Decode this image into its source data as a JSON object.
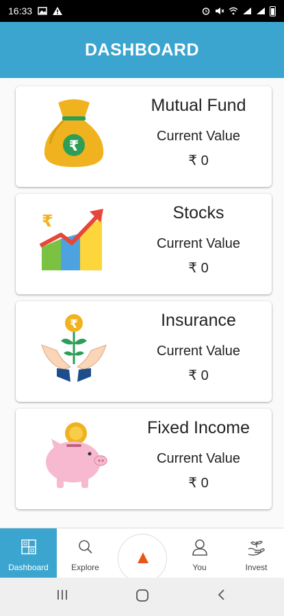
{
  "status_bar": {
    "time": "16:33",
    "right_icons": [
      "alarm-icon",
      "mute-icon",
      "wifi-icon",
      "signal-icon",
      "signal-icon",
      "battery-icon"
    ]
  },
  "header": {
    "title": "DASHBOARD",
    "color": "#3ba5cf"
  },
  "cards": [
    {
      "title": "Mutual Fund",
      "subtitle": "Current Value",
      "value": "₹ 0",
      "icon": "money-bag-icon"
    },
    {
      "title": "Stocks",
      "subtitle": "Current Value",
      "value": "₹ 0",
      "icon": "growth-chart-icon"
    },
    {
      "title": "Insurance",
      "subtitle": "Current Value",
      "value": "₹ 0",
      "icon": "hands-plant-icon"
    },
    {
      "title": "Fixed Income",
      "subtitle": "Current Value",
      "value": "₹ 0",
      "icon": "piggy-bank-icon"
    }
  ],
  "bottom_nav": {
    "items": [
      {
        "label": "Dashboard",
        "icon": "grid-icon",
        "active": true
      },
      {
        "label": "Explore",
        "icon": "search-icon",
        "active": false
      },
      {
        "label": "You",
        "icon": "user-icon",
        "active": false
      },
      {
        "label": "Invest",
        "icon": "invest-icon",
        "active": false
      }
    ],
    "center_icon": "triangle-logo-icon"
  },
  "system_nav": [
    "recent-apps-icon",
    "home-icon",
    "back-icon"
  ]
}
